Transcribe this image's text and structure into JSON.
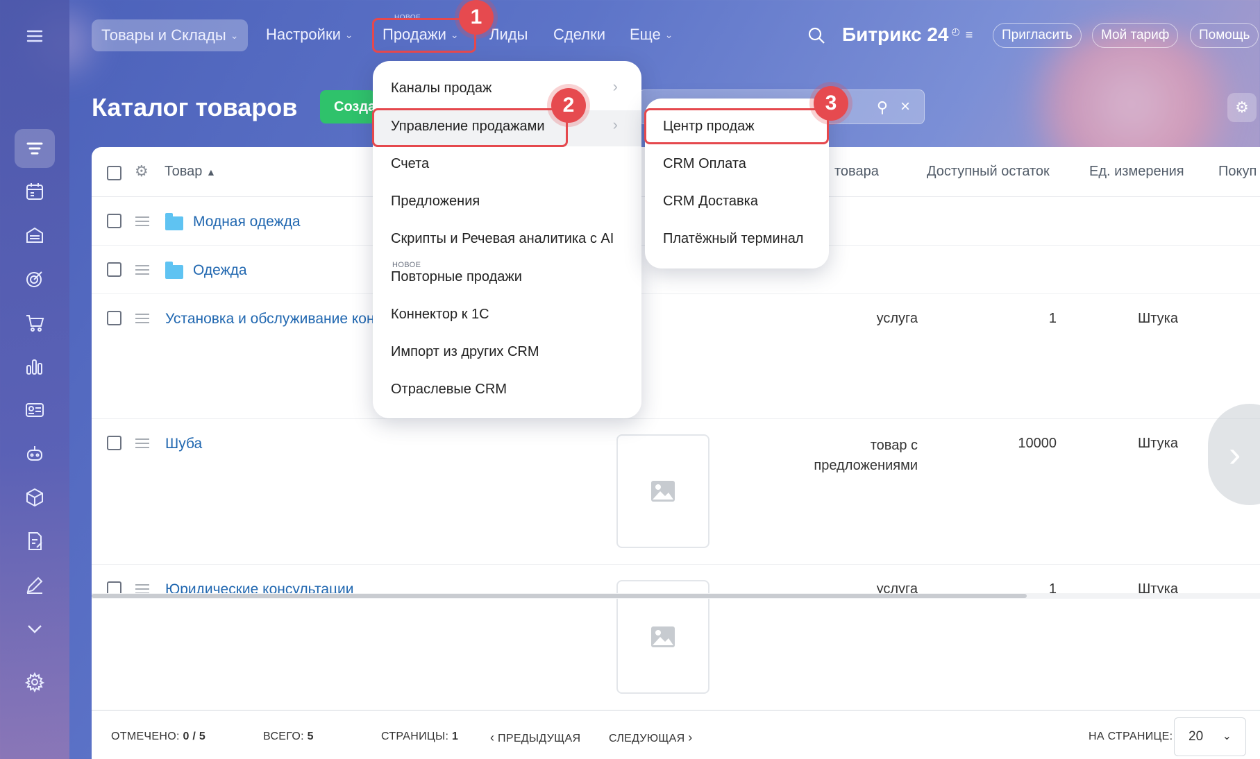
{
  "topbar": {
    "menu_icon": "hamburger-icon",
    "items": [
      {
        "label": "Товары и Склады"
      },
      {
        "label": "Настройки"
      },
      {
        "label": "Продажи",
        "badge_new": "НОВОЕ"
      },
      {
        "label": "Лиды"
      },
      {
        "label": "Сделки"
      },
      {
        "label": "Еще"
      }
    ],
    "brand": "Битрикс 24",
    "buttons": {
      "invite": "Пригласить",
      "tariff": "Мой тариф",
      "help": "Помощь"
    }
  },
  "sidebar": {
    "icons": [
      "filter-icon",
      "calendar-icon",
      "warehouse-icon",
      "target-icon",
      "cart-icon",
      "bar-chart-icon",
      "id-card-icon",
      "robot-icon",
      "box-icon",
      "document-edit-icon",
      "pen-icon",
      "chevron-down-icon",
      "settings-icon"
    ]
  },
  "page": {
    "title": "Каталог товаров",
    "create_label": "Создать"
  },
  "table": {
    "headers": {
      "product": "Товар",
      "type": "товара",
      "stock": "Доступный остаток",
      "unit": "Ед. измерения",
      "buy": "Покуп"
    },
    "rows": [
      {
        "name": "Модная одежда",
        "folder": true
      },
      {
        "name": "Одежда",
        "folder": true
      },
      {
        "name": "Установка и обслуживание кондиционеров",
        "type": "услуга",
        "stock": "1",
        "unit": "Штука"
      },
      {
        "name": "Шуба",
        "type": "товар с предложениями",
        "stock": "10000",
        "unit": "Штука"
      },
      {
        "name": "Юридические консультации",
        "type": "услуга",
        "stock": "1",
        "unit": "Штука"
      }
    ]
  },
  "footer": {
    "checked_label": "ОТМЕЧЕНО:",
    "checked_value": "0 / 5",
    "total_label": "ВСЕГО:",
    "total_value": "5",
    "pages_label": "СТРАНИЦЫ:",
    "pages_value": "1",
    "prev": "ПРЕДЫДУЩАЯ",
    "next": "СЛЕДУЮЩАЯ",
    "per_page_label": "НА СТРАНИЦЕ:",
    "per_page_value": "20"
  },
  "sales_menu": {
    "items": [
      {
        "label": "Каналы продаж",
        "submenu": true
      },
      {
        "label": "Управление продажами",
        "submenu": true
      },
      {
        "label": "Счета"
      },
      {
        "label": "Предложения"
      },
      {
        "label": "Скрипты и Речевая аналитика с AI"
      },
      {
        "label": "Повторные продажи",
        "badge_new": "НОВОЕ"
      },
      {
        "label": "Коннектор к 1С"
      },
      {
        "label": "Импорт из других CRM"
      },
      {
        "label": "Отраслевые CRM"
      }
    ]
  },
  "sales_submenu": {
    "items": [
      {
        "label": "Центр продаж"
      },
      {
        "label": "CRM Оплата"
      },
      {
        "label": "CRM Доставка"
      },
      {
        "label": "Платёжный терминал"
      }
    ]
  },
  "callouts": [
    "1",
    "2",
    "3"
  ],
  "colors": {
    "accent_red": "#e5484d",
    "create_green": "#2fc26b",
    "link_blue": "#2067b0"
  }
}
